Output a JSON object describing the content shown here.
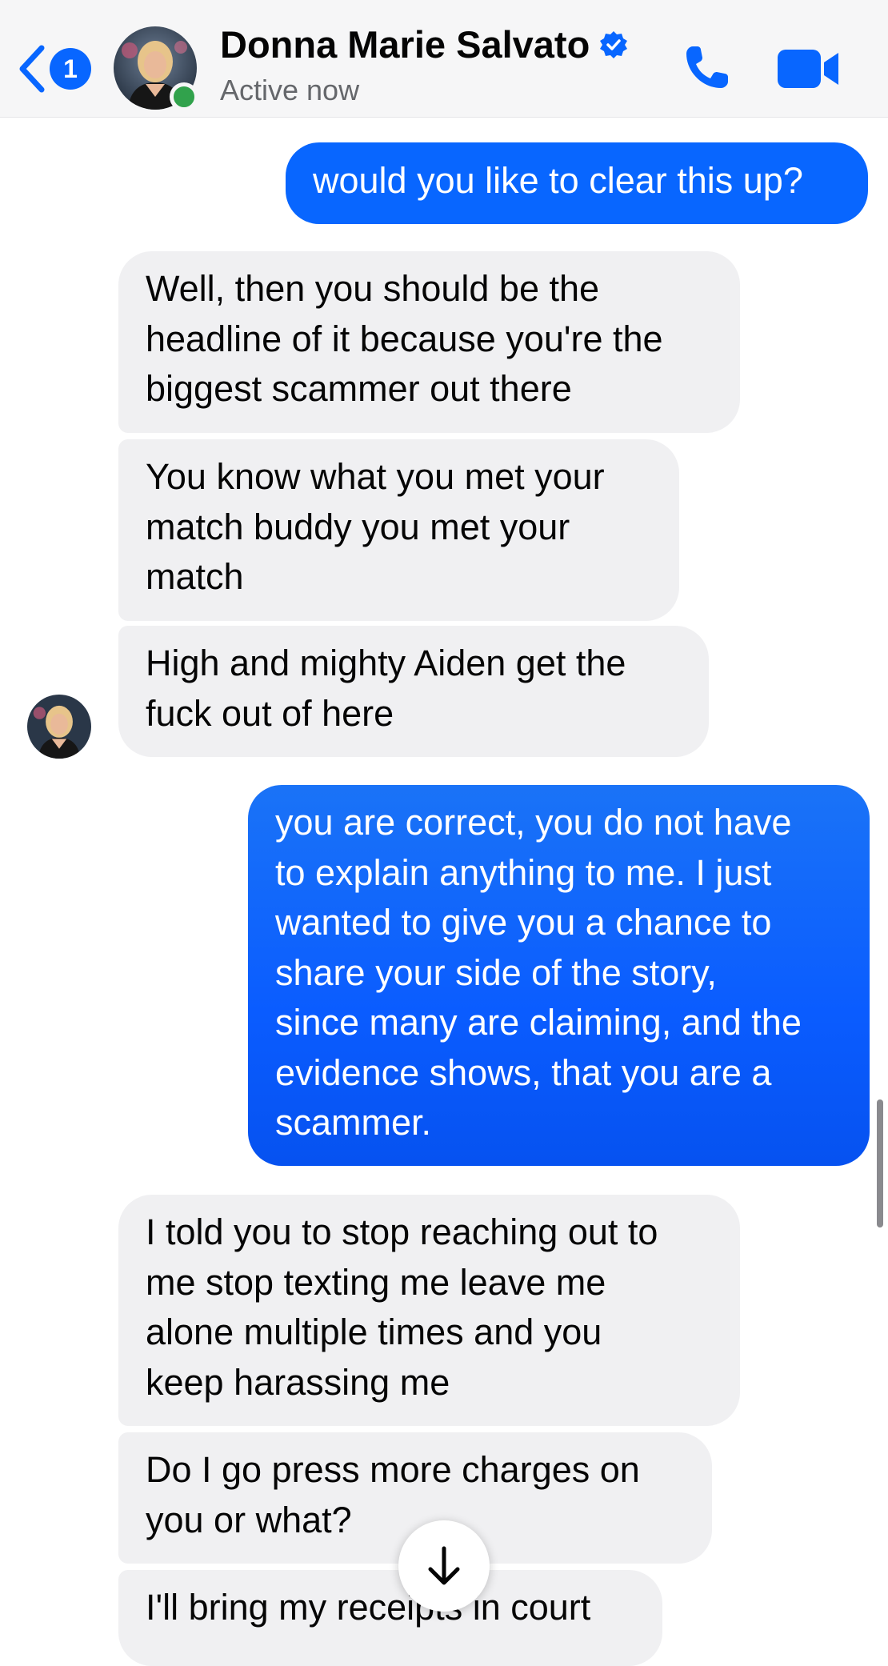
{
  "header": {
    "unread_count": "1",
    "contact_name": "Donna Marie Salvato",
    "status": "Active now"
  },
  "colors": {
    "accent": "#0866ff",
    "received_bubble": "#f0f0f2",
    "online": "#31a24c"
  },
  "messages": [
    {
      "from": "me",
      "lines": [
        "would you like to clear this up?"
      ]
    },
    {
      "from": "them",
      "lines": [
        "Well, then you should be the",
        "headline of it because you're the",
        "biggest scammer out there"
      ]
    },
    {
      "from": "them",
      "lines": [
        "You know what you met your",
        "match buddy you met your",
        "match"
      ]
    },
    {
      "from": "them",
      "lines": [
        "High and mighty Aiden get the",
        "fuck out of here"
      ]
    },
    {
      "from": "me",
      "lines": [
        "you are correct, you do not have",
        "to explain anything to me. I just",
        "wanted to give you a chance to",
        "share your side of the story,",
        "since many are claiming, and the",
        "evidence shows, that you are a",
        "scammer."
      ]
    },
    {
      "from": "them",
      "lines": [
        "I told you to stop reaching out to",
        "me stop texting me leave me",
        "alone multiple times and you",
        "keep harassing me"
      ]
    },
    {
      "from": "them",
      "lines": [
        "Do I go press more charges on",
        "you or what?"
      ]
    },
    {
      "from": "them",
      "lines": [
        "I'll bring my receipts in court"
      ]
    }
  ],
  "icons": {
    "back": "chevron-left-icon",
    "verified": "verified-badge-icon",
    "call": "phone-icon",
    "video": "video-camera-icon",
    "scroll_down": "arrow-down-icon"
  }
}
